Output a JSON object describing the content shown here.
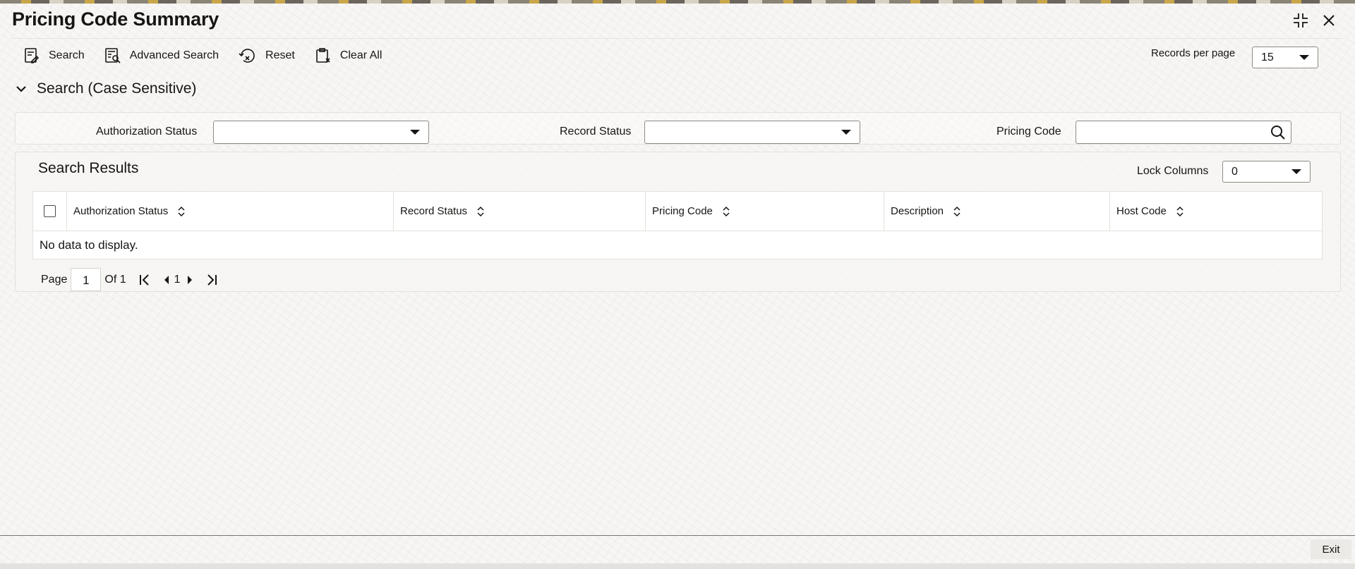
{
  "window": {
    "title": "Pricing Code Summary",
    "controls": {
      "minimize_icon": "compress-icon",
      "close_icon": "close-icon"
    }
  },
  "toolbar": {
    "buttons": [
      {
        "label": "Search",
        "icon": "search-form-icon"
      },
      {
        "label": "Advanced Search",
        "icon": "advanced-search-icon"
      },
      {
        "label": "Reset",
        "icon": "reset-icon"
      },
      {
        "label": "Clear All",
        "icon": "clear-all-icon"
      }
    ],
    "records_per_page": {
      "label": "Records per page",
      "value": "15"
    }
  },
  "search_section": {
    "title": "Search (Case Sensitive)",
    "fields": [
      {
        "label": "Authorization Status",
        "value": ""
      },
      {
        "label": "Record Status",
        "value": ""
      },
      {
        "label": "Pricing Code",
        "value": ""
      }
    ]
  },
  "results": {
    "title": "Search Results",
    "lock_columns": {
      "label": "Lock Columns",
      "value": "0"
    },
    "columns": [
      "Authorization Status",
      "Record Status",
      "Pricing Code",
      "Description",
      "Host Code"
    ],
    "rows": [],
    "empty_message": "No data to display."
  },
  "pagination": {
    "page_label": "Page",
    "current_page": "1",
    "of_label": "Of 1",
    "page_number": "1"
  },
  "footer": {
    "exit_label": "Exit"
  },
  "colors": {
    "background": "#f7f6f4",
    "text": "#161513",
    "border": "#8f8b85"
  }
}
